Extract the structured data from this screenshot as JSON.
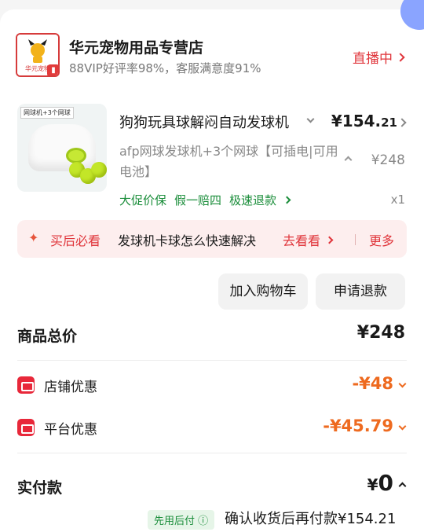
{
  "store": {
    "logo_text": "华元宠物",
    "name": "华元宠物用品专营店",
    "subtitle": "88VIP好评率98%，客服满意度91%",
    "live_label": "直播中"
  },
  "product": {
    "thumb_tag": "网球机+3个网球",
    "title": "狗狗玩具球解闷自动发球机",
    "price_main": "¥154.",
    "price_cents": "21",
    "spec": "afp网球发球机+3个网球【可插电|可用电池】",
    "original_price": "¥248",
    "tags": [
      "大促价保",
      "假一赔四",
      "极速退款"
    ],
    "quantity": "x1"
  },
  "after_sale": {
    "label": "买后必看",
    "question": "发球机卡球怎么快速解决",
    "go_label": "去看看",
    "more_label": "更多"
  },
  "actions": {
    "cart_label": "加入购物车",
    "refund_label": "申请退款"
  },
  "totals": {
    "goods_label": "商品总价",
    "goods_value": "¥248",
    "store_discount_label": "店铺优惠",
    "store_discount_value": "-¥48",
    "platform_discount_label": "平台优惠",
    "platform_discount_value": "-¥45.79",
    "paid_label": "实付款",
    "paid_symbol": "¥",
    "paid_value": "0",
    "pay_later_badge": "先用后付 ⓘ",
    "pay_later_text": "确认收货后再付款¥154.21"
  },
  "colors": {
    "accent_red": "#e0353b",
    "discount_orange": "#ee6a1f",
    "green": "#1a8d3a"
  }
}
